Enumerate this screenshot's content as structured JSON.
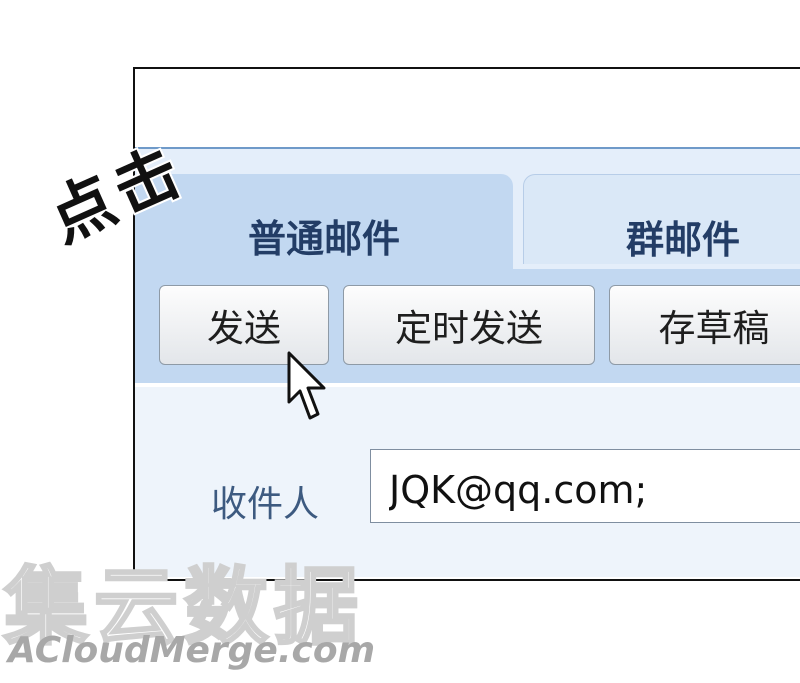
{
  "tabs": {
    "normal_mail": "普通邮件",
    "group_mail": "群邮件"
  },
  "toolbar": {
    "send": "发送",
    "timed_send": "定时发送",
    "save_draft": "存草稿"
  },
  "form": {
    "recipient_label": "收件人",
    "recipient_value": "JQK@qq.com;"
  },
  "annotation": {
    "click_text": "点击"
  },
  "watermark": {
    "chinese": "集云数据",
    "english": "ACloudMerge.com"
  },
  "colors": {
    "tab_active": "#c2d8f1",
    "tab_inactive": "#dae8f7",
    "label_text": "#3d5a80",
    "divider": "#6f9ac9"
  },
  "icons": {
    "cursor": "arrow-pointer"
  }
}
